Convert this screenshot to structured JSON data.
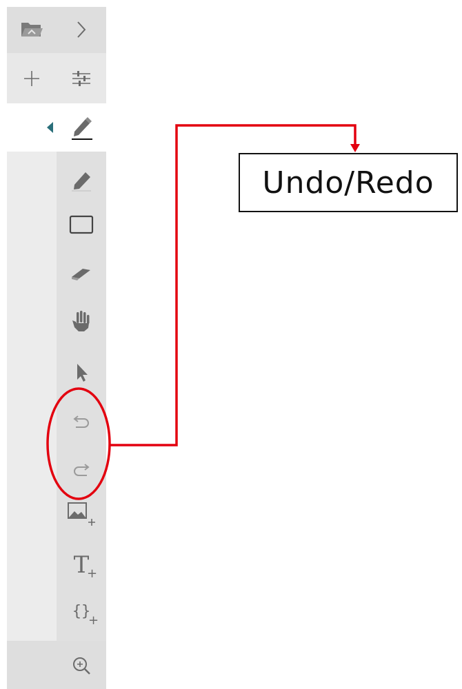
{
  "toolbar": {
    "tools": [
      {
        "id": "open-folder",
        "icon": "folder-open-icon"
      },
      {
        "id": "expand",
        "icon": "chevron-right-icon"
      },
      {
        "id": "add",
        "icon": "plus-icon"
      },
      {
        "id": "settings",
        "icon": "sliders-icon"
      },
      {
        "id": "pen",
        "icon": "pen-icon",
        "active": true
      },
      {
        "id": "highlighter",
        "icon": "highlighter-icon"
      },
      {
        "id": "rectangle",
        "icon": "rectangle-icon"
      },
      {
        "id": "eraser",
        "icon": "eraser-icon"
      },
      {
        "id": "pan",
        "icon": "hand-icon"
      },
      {
        "id": "select",
        "icon": "cursor-icon"
      },
      {
        "id": "undo",
        "icon": "undo-icon",
        "disabled": true
      },
      {
        "id": "redo",
        "icon": "redo-icon",
        "disabled": true
      },
      {
        "id": "insert-image",
        "icon": "image-plus-icon"
      },
      {
        "id": "insert-text",
        "icon": "text-plus-icon",
        "glyph": "T",
        "suffix": "+"
      },
      {
        "id": "insert-code",
        "icon": "braces-plus-icon",
        "glyph": "{}",
        "suffix": "+"
      },
      {
        "id": "zoom",
        "icon": "zoom-in-icon"
      }
    ],
    "icon_color": "#6b6b6b",
    "active_indicator_color": "#2a6f7a"
  },
  "annotation": {
    "label": "Undo/Redo",
    "highlight_color": "#e3000f"
  }
}
